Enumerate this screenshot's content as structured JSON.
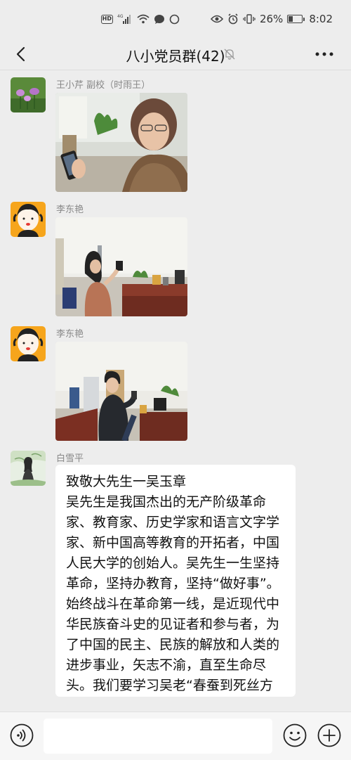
{
  "status_bar": {
    "hd": "HD",
    "signal_label": "4G",
    "battery": "26%",
    "battery_level": 0.26,
    "time": "8:02"
  },
  "header": {
    "title": "八小党员群(42)",
    "muted": true
  },
  "messages": [
    {
      "sender": "王小芹 副校（时雨王）",
      "type": "image"
    },
    {
      "sender": "李东艳",
      "type": "image"
    },
    {
      "sender": "李东艳",
      "type": "image"
    },
    {
      "sender": "白雪平",
      "type": "text",
      "title": "致敬大先生一吴玉章",
      "body": "吴先生是我国杰出的无产阶级革命家、教育家、历史学家和语言文字学家、新中国高等教育的开拓者，中国人民大学的创始人。吴先生一生坚持革命，坚持办教育，坚持“做好事”。始终战斗在革命第一线，是近现代中华民族奋斗史的见证者和参与者，为了中国的民主、民族的解放和人类的进步事业，矢志不渝，直至生命尽头。我们要学习吴老“春蚕到死丝方尽”的革命精神，"
    }
  ],
  "input_bar": {
    "placeholder": ""
  },
  "colors": {
    "background": "#ededed",
    "bubble": "#ffffff",
    "sender_name": "#888888"
  },
  "icons": [
    "back-arrow-icon",
    "mute-bell-icon",
    "more-dots-icon",
    "voice-icon",
    "emoji-icon",
    "plus-icon"
  ]
}
